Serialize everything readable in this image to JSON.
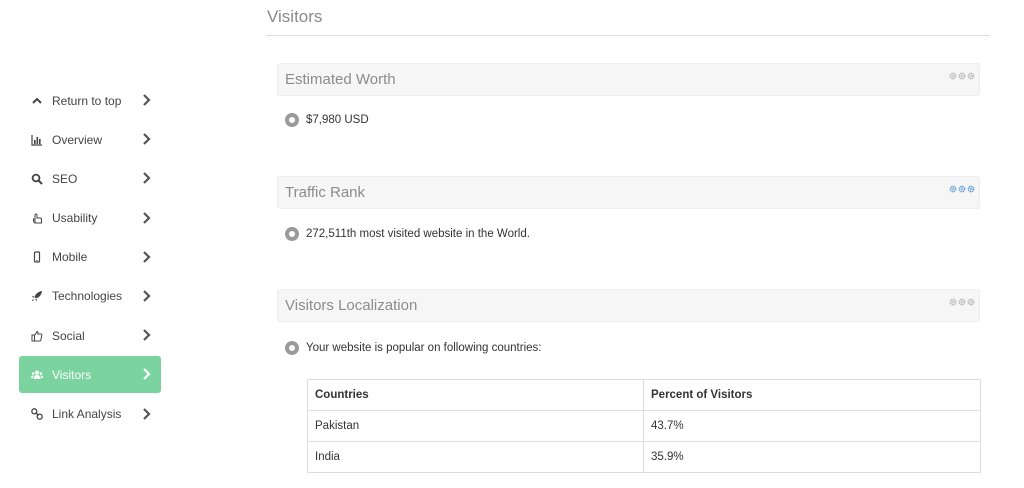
{
  "page": {
    "title": "Visitors"
  },
  "sidebar": {
    "items": [
      {
        "label": "Return to top",
        "icon": "chevron-up-icon",
        "active": false
      },
      {
        "label": "Overview",
        "icon": "bar-chart-icon",
        "active": false
      },
      {
        "label": "SEO",
        "icon": "search-icon",
        "active": false
      },
      {
        "label": "Usability",
        "icon": "pointer-hand-icon",
        "active": false
      },
      {
        "label": "Mobile",
        "icon": "mobile-phone-icon",
        "active": false
      },
      {
        "label": "Technologies",
        "icon": "rocket-icon",
        "active": false
      },
      {
        "label": "Social",
        "icon": "thumbs-up-icon",
        "active": false
      },
      {
        "label": "Visitors",
        "icon": "users-icon",
        "active": true
      },
      {
        "label": "Link Analysis",
        "icon": "link-icon",
        "active": false
      }
    ],
    "active_color": "#7bd3a0"
  },
  "sections": {
    "estimated_worth": {
      "title": "Estimated Worth",
      "value": "$7,980 USD",
      "gear_color": "#b3b3b3"
    },
    "traffic_rank": {
      "title": "Traffic Rank",
      "value": "272,511th most visited website in the World.",
      "gear_color": "#5a9bd4"
    },
    "visitors_localization": {
      "title": "Visitors Localization",
      "value": "Your website is popular on following countries:",
      "gear_color": "#b3b3b3",
      "table": {
        "headers": [
          "Countries",
          "Percent of Visitors"
        ],
        "rows": [
          [
            "Pakistan",
            "43.7%"
          ],
          [
            "India",
            "35.9%"
          ]
        ]
      }
    }
  }
}
